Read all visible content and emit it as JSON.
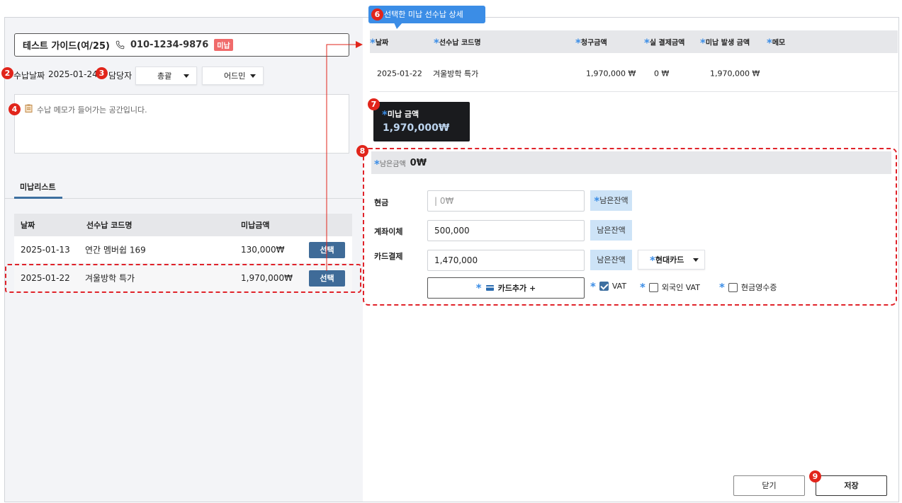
{
  "customer": {
    "name": "테스트 가이드(여/25)",
    "phone": "010-1234-9876",
    "status": "미납"
  },
  "payment_date": {
    "label": "수납날짜",
    "value": "2025-01-24"
  },
  "staff": {
    "label": "담당자",
    "option1": "총괄",
    "option2": "어드민"
  },
  "memo": {
    "placeholder": "수납 메모가 들어가는 공간입니다."
  },
  "tab": {
    "label": "미납리스트"
  },
  "unpaid_list": {
    "headers": [
      "날짜",
      "선수납 코드명",
      "미납금액"
    ],
    "rows": [
      {
        "date": "2025-01-13",
        "code": "연간 멤버쉽 169",
        "amount": "130,000₩",
        "button": "선택"
      },
      {
        "date": "2025-01-22",
        "code": "겨울방학 특가",
        "amount": "1,970,000₩",
        "button": "선택"
      }
    ]
  },
  "tooltip": {
    "text": "선택한 미납 선수납  상세"
  },
  "detail": {
    "headers": [
      "날짜",
      "선수납 코드명",
      "청구금액",
      "실 결제금액",
      "미납 발생 금액",
      "메모"
    ],
    "row": {
      "date": "2025-01-22",
      "code": "겨울방학 특가",
      "billed": "1,970,000 ₩",
      "paid": "0 ₩",
      "unpaid": "1,970,000 ₩",
      "memo": ""
    }
  },
  "unpaid_amount": {
    "label": "미납 금액",
    "value": "1,970,000₩"
  },
  "remaining": {
    "label": "남은금액",
    "value": "0₩"
  },
  "payment": {
    "cash": {
      "label": "현금",
      "placeholder": "| 0₩",
      "remain_btn": "남은잔액"
    },
    "transfer": {
      "label": "계좌이체",
      "value": "500,000",
      "remain_btn": "남은잔액"
    },
    "card": {
      "label": "카드결제",
      "value": "1,470,000",
      "remain_btn": "남은잔액",
      "card_type": "현대카드"
    },
    "add_card": "카드추가 +",
    "options": [
      {
        "label": "VAT",
        "checked": true
      },
      {
        "label": "외국인 VAT",
        "checked": false
      },
      {
        "label": "현금영수증",
        "checked": false
      }
    ]
  },
  "footer": {
    "close": "닫기",
    "save": "저장"
  },
  "markers": {
    "m2": "2",
    "m3": "3",
    "m4": "4",
    "m6": "6",
    "m7": "7",
    "m8": "8",
    "m9": "9"
  },
  "colors": {
    "accent": "#3d6fa0",
    "marker": "#e1251b",
    "tooltip": "#3b8de6",
    "remain_btn": "#cde3f7"
  }
}
